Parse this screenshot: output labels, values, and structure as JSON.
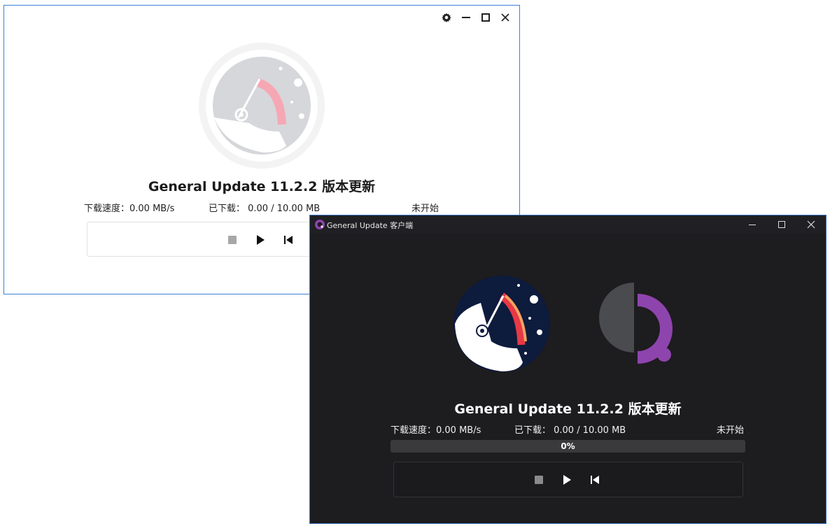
{
  "light_window": {
    "title": "General Update 11.2.2 版本更新",
    "speed": "下载速度：0.00 MB/s",
    "downloaded": "已下载：  0.00 / 10.00 MB",
    "status": "未开始",
    "icons": [
      "gear-icon",
      "minimize-icon",
      "maximize-icon",
      "close-icon",
      "stop-icon",
      "play-icon",
      "skip-back-icon"
    ]
  },
  "dark_window": {
    "window_title": "General Update 客户端",
    "title": "General Update 11.2.2 版本更新",
    "speed": "下载速度：0.00 MB/s",
    "downloaded": "已下载：  0.00 / 10.00 MB",
    "status": "未开始",
    "progress_text": "0%",
    "progress_value": 0,
    "icons": [
      "app-icon",
      "minimize-icon",
      "maximize-icon",
      "close-icon",
      "stop-icon",
      "play-icon",
      "skip-back-icon"
    ]
  },
  "colors": {
    "accent_purple": "#8e44ad",
    "dark_background": "#1d1c1f",
    "window_border": "#3c7fd6"
  }
}
